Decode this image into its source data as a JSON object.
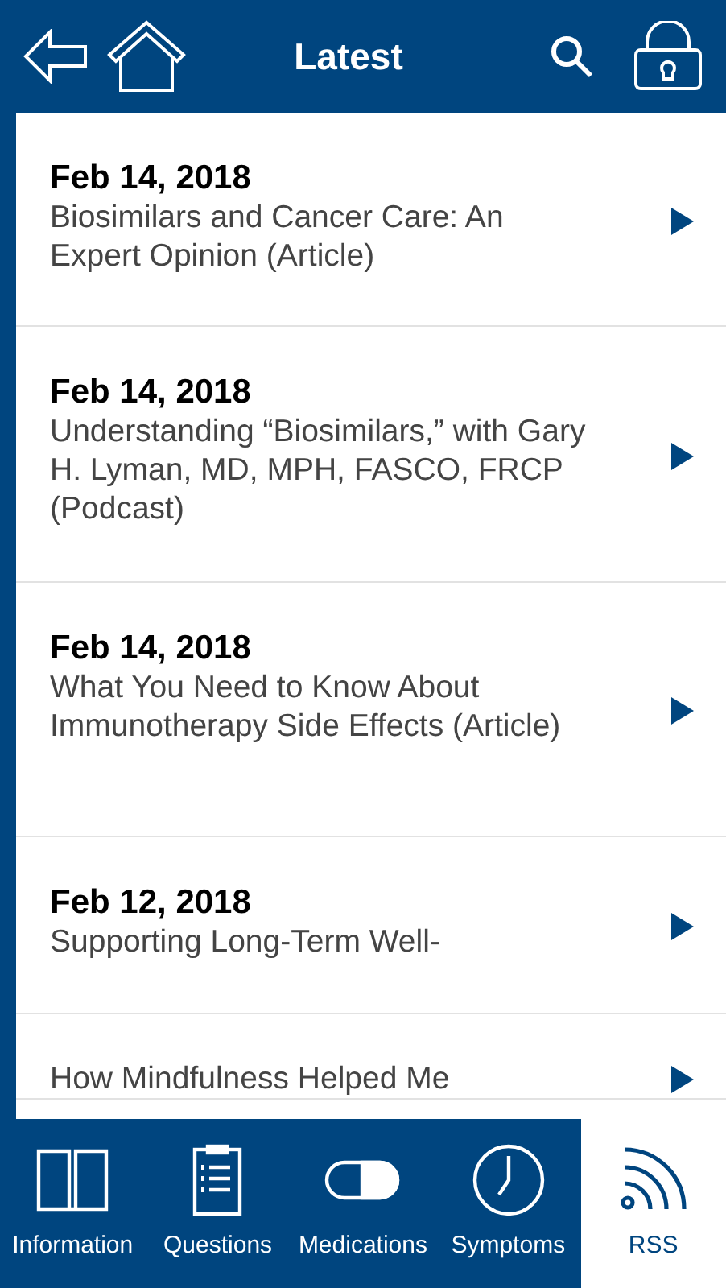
{
  "header": {
    "title": "Latest"
  },
  "articles": [
    {
      "date": "Feb 14, 2018",
      "title": "Biosimilars and Cancer Care: An Expert Opinion (Article)"
    },
    {
      "date": "Feb 14, 2018",
      "title": "Understanding “Biosimilars,” with Gary H. Lyman, MD, MPH, FASCO, FRCP (Podcast)"
    },
    {
      "date": "Feb 14, 2018",
      "title": "What You Need to Know About Immunotherapy Side Effects (Article)"
    },
    {
      "date": "Feb 12, 2018",
      "title": "Supporting Long-Term Well-"
    },
    {
      "title": "How Mindfulness Helped Me"
    }
  ],
  "tabs": [
    {
      "kind": "book",
      "label": "Information",
      "selected": false
    },
    {
      "kind": "clipboard",
      "label": "Questions",
      "selected": false
    },
    {
      "kind": "pill",
      "label": "Medications",
      "selected": false
    },
    {
      "kind": "clock",
      "label": "Symptoms",
      "selected": false
    },
    {
      "kind": "rss",
      "label": "RSS",
      "selected": true
    }
  ]
}
